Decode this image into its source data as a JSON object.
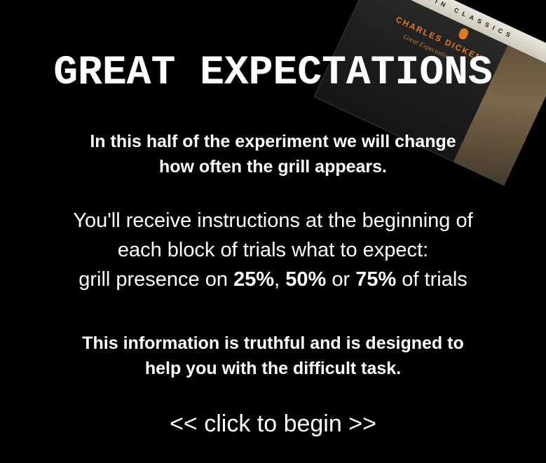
{
  "book_cover": {
    "band_text": "PENGUIN CLASSICS",
    "author": "CHARLES DICKENS",
    "subtitle": "Great Expectations",
    "colors": {
      "accent": "#e07a1f",
      "cover": "#1c1c1c"
    }
  },
  "title": "GREAT EXPECTATIONS",
  "intro": {
    "line1": "In this half of the experiment we will change",
    "line2": "how often the grill appears."
  },
  "instructions": {
    "line1": "You'll receive instructions at the beginning of",
    "line2": "each block of trials what to expect:",
    "line3_prefix": "grill presence on ",
    "pct_a": "25%",
    "sep1": ", ",
    "pct_b": "50%",
    "sep2": " or ",
    "pct_c": "75%",
    "line3_suffix": " of trials"
  },
  "note": {
    "line1": "This information is truthful and is designed to",
    "line2": "help you with the difficult task."
  },
  "begin_label": "<< click to begin >>"
}
